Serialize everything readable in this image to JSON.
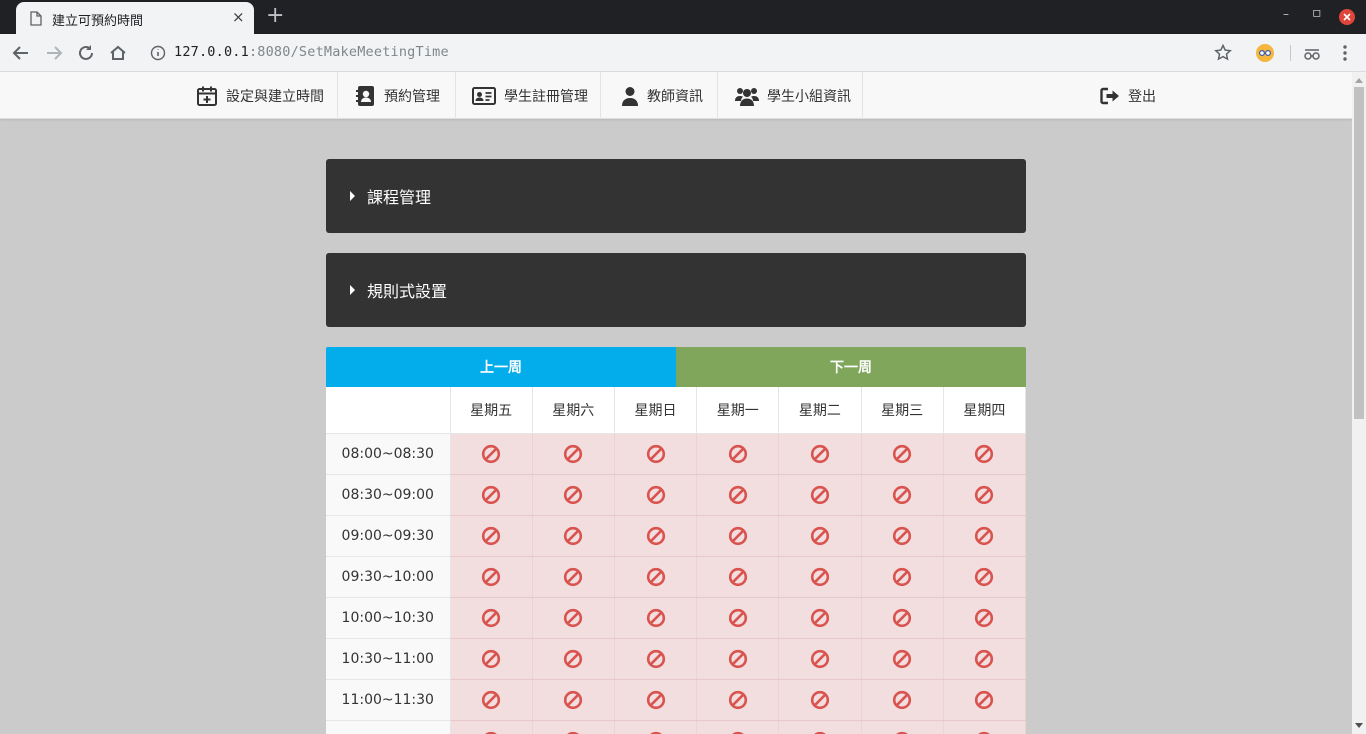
{
  "browser": {
    "tab_title": "建立可預約時間",
    "tab_close": "×",
    "new_tab": "+",
    "url_host": "127.0.0.1",
    "url_rest": ":8080/SetMakeMeetingTime",
    "win_minimize": "–",
    "win_restore": "▫"
  },
  "navbar": {
    "items": [
      {
        "label": "設定與建立時間",
        "icon": "calendar-plus-icon"
      },
      {
        "label": "預約管理",
        "icon": "contact-card-icon"
      },
      {
        "label": "學生註冊管理",
        "icon": "id-card-icon"
      },
      {
        "label": "教師資訊",
        "icon": "user-icon"
      },
      {
        "label": "學生小組資訊",
        "icon": "users-icon"
      }
    ],
    "logout_label": "登出"
  },
  "panels": {
    "course": "課程管理",
    "rules": "規則式設置"
  },
  "week_nav": {
    "prev": "上一周",
    "next": "下一周"
  },
  "schedule": {
    "days": [
      "星期五",
      "星期六",
      "星期日",
      "星期一",
      "星期二",
      "星期三",
      "星期四"
    ],
    "slots": [
      "08:00~08:30",
      "08:30~09:00",
      "09:00~09:30",
      "09:30~10:00",
      "10:00~10:30",
      "10:30~11:00",
      "11:00~11:30",
      ""
    ],
    "cell_state": "unavailable",
    "cell_icon": "ban-icon"
  },
  "colors": {
    "prev_week": "#03acea",
    "next_week": "#80a65c",
    "panel": "#333333",
    "unavailable_cell": "#f2dede",
    "ban_icon": "#d9534f"
  }
}
